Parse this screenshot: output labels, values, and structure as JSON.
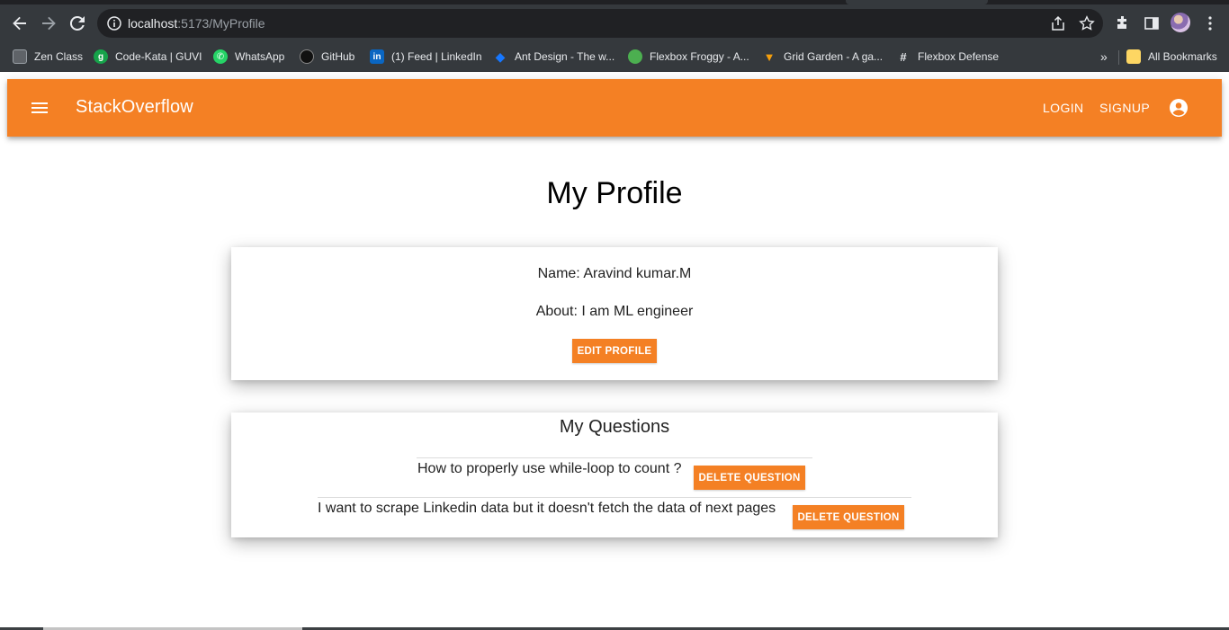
{
  "browser": {
    "url_host": "localhost",
    "url_path": ":5173/MyProfile",
    "bookmarks": [
      {
        "label": "Zen Class",
        "icon": "zen-class-icon"
      },
      {
        "label": "Code-Kata | GUVI",
        "icon": "guvi-icon"
      },
      {
        "label": "WhatsApp",
        "icon": "whatsapp-icon"
      },
      {
        "label": "GitHub",
        "icon": "github-icon"
      },
      {
        "label": "(1) Feed | LinkedIn",
        "icon": "linkedin-icon"
      },
      {
        "label": "Ant Design - The w...",
        "icon": "ant-design-icon"
      },
      {
        "label": "Flexbox Froggy - A...",
        "icon": "frog-icon"
      },
      {
        "label": "Grid Garden - A ga...",
        "icon": "carrot-icon"
      },
      {
        "label": "Flexbox Defense",
        "icon": "defense-icon"
      }
    ],
    "bookmarks_overflow": "»",
    "all_bookmarks": "All Bookmarks"
  },
  "appbar": {
    "brand": "StackOverflow",
    "login": "Login",
    "signup": "Signup",
    "color": "#f48024"
  },
  "page": {
    "title": "My Profile"
  },
  "profile": {
    "name_line": "Name: Aravind kumar.M",
    "about_line": "About: I am ML engineer",
    "edit_button": "Edit Profile"
  },
  "questions": {
    "heading": "My Questions",
    "items": [
      {
        "text": "How to properly use while-loop to count ?",
        "delete_label": "Delete Question"
      },
      {
        "text": "I want to scrape Linkedin data but it doesn't fetch the data of next pages",
        "delete_label": "Delete Question"
      }
    ]
  }
}
